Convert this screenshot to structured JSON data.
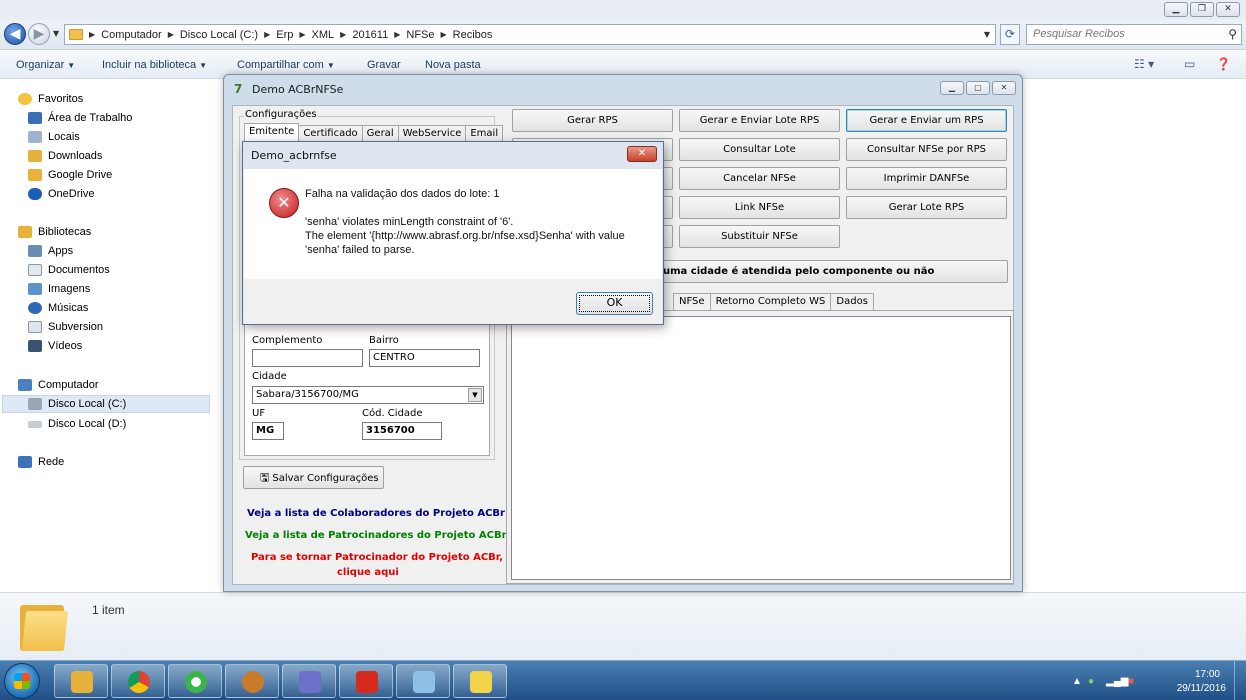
{
  "explorer": {
    "breadcrumbs": [
      "Computador",
      "Disco Local (C:)",
      "Erp",
      "XML",
      "201611",
      "NFSe",
      "Recibos"
    ],
    "search_placeholder": "Pesquisar Recibos",
    "toolbar": {
      "organize": "Organizar",
      "include_library": "Incluir na biblioteca",
      "share": "Compartilhar com",
      "burn": "Gravar",
      "new_folder": "Nova pasta"
    },
    "nav": {
      "favorites": "Favoritos",
      "desktop": "Área de Trabalho",
      "places": "Locais",
      "downloads": "Downloads",
      "google_drive": "Google Drive",
      "onedrive": "OneDrive",
      "libraries": "Bibliotecas",
      "apps": "Apps",
      "documents": "Documentos",
      "images": "Imagens",
      "music": "Músicas",
      "subversion": "Subversion",
      "videos": "Vídeos",
      "computer": "Computador",
      "disk_c": "Disco Local (C:)",
      "disk_d": "Disco Local (D:)",
      "network": "Rede"
    },
    "details_count": "1 item"
  },
  "acbr": {
    "title": "Demo ACBrNFSe",
    "config_caption": "Configurações",
    "tabs": [
      "Emitente",
      "Certificado",
      "Geral",
      "WebService",
      "Email"
    ],
    "labels": {
      "complemento": "Complemento",
      "bairro": "Bairro",
      "cidade": "Cidade",
      "uf": "UF",
      "cod_cidade": "Cód. Cidade"
    },
    "values": {
      "complemento": "",
      "bairro": "CENTRO",
      "cidade": "Sabara/3156700/MG",
      "uf": "MG",
      "cod_cidade": "3156700"
    },
    "save_config": "Salvar Configurações",
    "links": {
      "colaboradores": "Veja a lista de Colaboradores do Projeto ACBr",
      "patrocinadores": "Veja a lista de Patrocinadores do Projeto ACBr",
      "patrocinador_line1": "Para se tornar Patrocinador do Projeto ACBr,",
      "patrocinador_line2": "clique aqui"
    },
    "buttons": {
      "gerar_rps": "Gerar RPS",
      "gerar_enviar_lote": "Gerar e Enviar Lote RPS",
      "gerar_enviar_um": "Gerar e Enviar um RPS",
      "consultar_lote": "Consultar Lote",
      "consultar_nfse_rps": "Consultar NFSe por RPS",
      "cancelar_nfse": "Cancelar NFSe",
      "imprimir_danfse": "Imprimir DANFSe",
      "link_nfse": "Link NFSe",
      "gerar_lote_rps": "Gerar Lote RPS",
      "substituir_nfse": "Substituir NFSe",
      "cidade_atendida": "uma cidade é atendida pelo componente ou não"
    },
    "result_tabs": [
      "NFSe",
      "Retorno Completo WS",
      "Dados"
    ]
  },
  "dialog": {
    "title": "Demo_acbrnfse",
    "line1": "Falha na validação dos dados do lote: 1",
    "line2": "'senha' violates minLength constraint of '6'.",
    "line3": "The element '{http://www.abrasf.org.br/nfse.xsd}Senha' with value",
    "line4": "'senha' failed to parse.",
    "ok": "OK"
  },
  "taskbar": {
    "time": "17:00",
    "date": "29/11/2016"
  },
  "colors": {
    "link_blue": "#00007f",
    "link_green": "#008000",
    "link_red": "#e00000",
    "taskbar": "#1f4f86"
  }
}
